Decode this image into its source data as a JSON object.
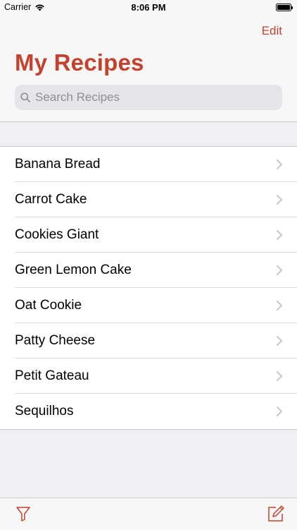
{
  "status_bar": {
    "carrier": "Carrier",
    "time": "8:06 PM",
    "wifi_icon": "wifi-icon",
    "battery_icon": "battery-full-icon"
  },
  "nav": {
    "edit_label": "Edit",
    "title": "My Recipes"
  },
  "search": {
    "placeholder": "Search Recipes",
    "value": "",
    "icon": "search-icon"
  },
  "recipes": [
    {
      "name": "Banana Bread"
    },
    {
      "name": "Carrot Cake"
    },
    {
      "name": "Cookies Giant"
    },
    {
      "name": "Green Lemon Cake"
    },
    {
      "name": "Oat Cookie"
    },
    {
      "name": "Patty Cheese"
    },
    {
      "name": "Petit Gateau"
    },
    {
      "name": "Sequilhos"
    }
  ],
  "toolbar": {
    "left_icon": "filter-icon",
    "right_icon": "compose-icon"
  },
  "colors": {
    "accent": "#c4422d",
    "background": "#efeff4",
    "bar_background": "#f7f7f7",
    "separator": "#c8c7cc",
    "placeholder": "#8e8e93",
    "search_field": "#e4e4e9"
  }
}
